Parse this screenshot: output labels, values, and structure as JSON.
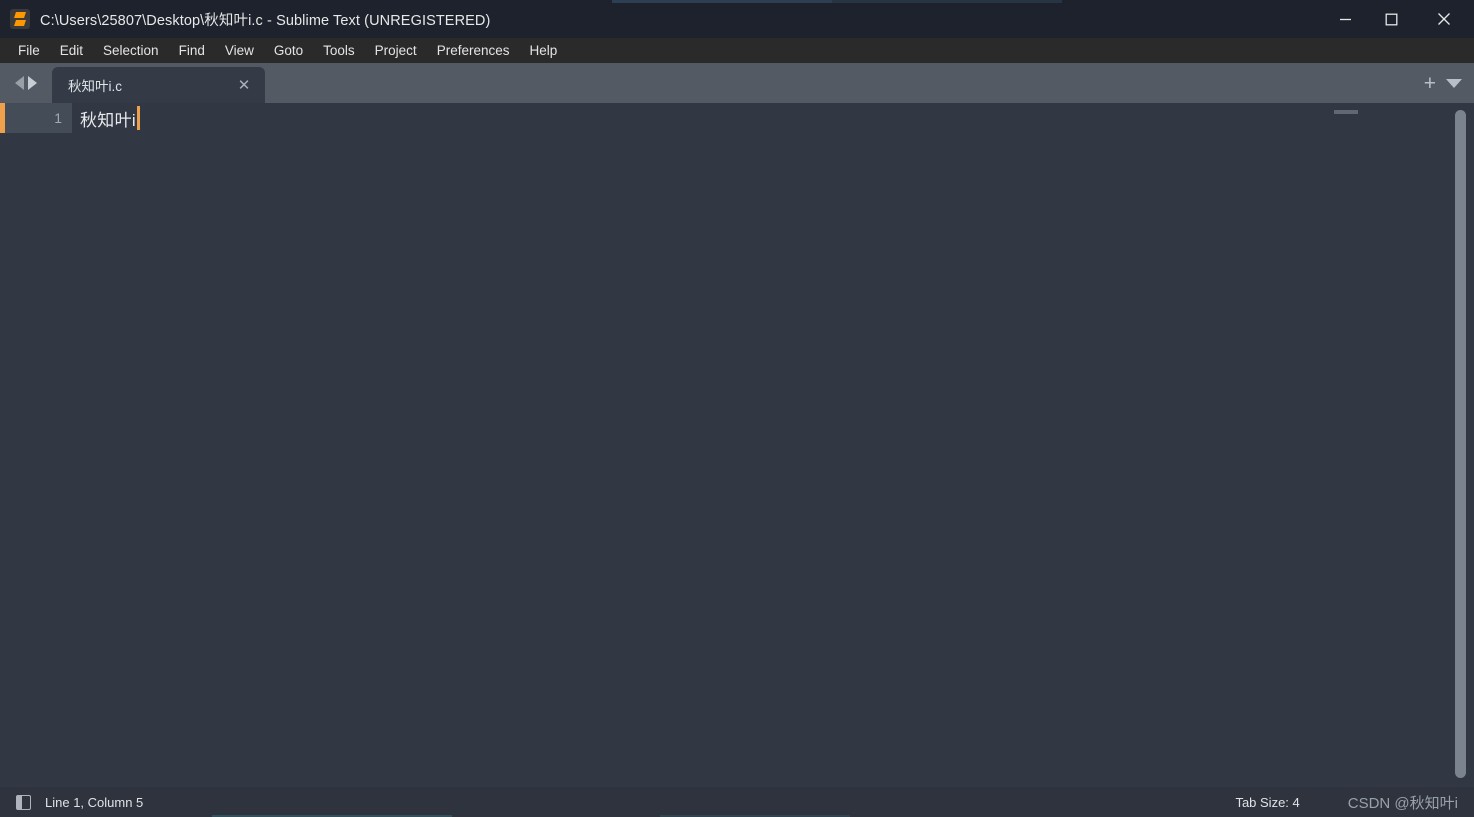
{
  "window": {
    "title": "C:\\Users\\25807\\Desktop\\秋知叶i.c - Sublime Text (UNREGISTERED)",
    "logo_icon": "sublime-text-logo-icon",
    "controls": {
      "minimize": "minimize-icon",
      "maximize": "maximize-icon",
      "close": "close-icon"
    }
  },
  "menubar": {
    "items": [
      {
        "label": "File"
      },
      {
        "label": "Edit"
      },
      {
        "label": "Selection"
      },
      {
        "label": "Find"
      },
      {
        "label": "View"
      },
      {
        "label": "Goto"
      },
      {
        "label": "Tools"
      },
      {
        "label": "Project"
      },
      {
        "label": "Preferences"
      },
      {
        "label": "Help"
      }
    ]
  },
  "tabbar": {
    "nav_prev_icon": "chevron-left-icon",
    "nav_next_icon": "chevron-right-icon",
    "tabs": [
      {
        "label": "秋知叶i.c",
        "close_label": "✕",
        "active": true
      }
    ],
    "new_tab_label": "+",
    "tab_menu_icon": "chevron-down-icon"
  },
  "editor": {
    "lines": [
      {
        "number": "1",
        "text": "秋知叶i"
      }
    ],
    "cursor_color": "#f0a04b"
  },
  "statusbar": {
    "sidebar_toggle_icon": "sidebar-toggle-icon",
    "position": "Line 1, Column 5",
    "tab_size": "Tab Size: 4",
    "watermark": "CSDN @秋知叶i"
  },
  "colors": {
    "titlebar_bg": "#1d222c",
    "menubar_bg": "#2a2a2a",
    "tabbar_bg": "#535a63",
    "tab_active_bg": "#343b46",
    "editor_bg": "#323843",
    "statusbar_bg": "#2e333d",
    "accent": "#f0a04b"
  }
}
